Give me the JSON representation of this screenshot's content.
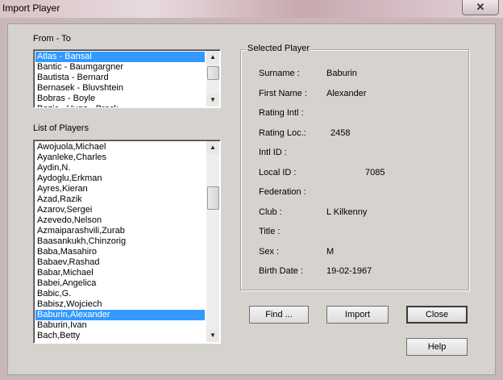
{
  "window": {
    "title": "Import Player",
    "close_glyph": "✕"
  },
  "from_to": {
    "label": "From - To",
    "items": [
      "Atlas - Bansal",
      "Bantic - Baumgargner",
      "Bautista - Bernard",
      "Bernasek - Bluvshtein",
      "Bobras - Boyle",
      "Bozic - Hugo - Brock"
    ],
    "selected_index": 0
  },
  "players": {
    "label": "List of Players",
    "items": [
      "Awojuola,Michael",
      "Ayanleke,Charles",
      "Aydin,N.",
      "Aydoglu,Erkman",
      "Ayres,Kieran",
      "Azad,Razik",
      "Azarov,Sergei",
      "Azevedo,Nelson",
      "Azmaiparashvili,Zurab",
      "Baasankukh,Chinzorig",
      "Baba,Masahiro",
      "Babaev,Rashad",
      "Babar,Michael",
      "Babei,Angelica",
      "Babic,G.",
      "Babisz,Wojciech",
      "Baburin,Alexander",
      "Baburin,Ivan",
      "Bach,Betty"
    ],
    "selected_index": 16
  },
  "selected_player": {
    "legend": "Selected Player",
    "fields": [
      {
        "label": "Surname :",
        "value": "Baburin"
      },
      {
        "label": "First Name :",
        "value": "Alexander"
      },
      {
        "label": "Rating Intl :",
        "value": ""
      },
      {
        "label": "Rating Loc.:",
        "value": "2458"
      },
      {
        "label": "Intl ID :",
        "value": ""
      },
      {
        "label": "Local ID :",
        "value": "7085"
      },
      {
        "label": "Federation :",
        "value": ""
      },
      {
        "label": "Club :",
        "value": "L Kilkenny"
      },
      {
        "label": "Title :",
        "value": ""
      },
      {
        "label": "Sex :",
        "value": "M"
      },
      {
        "label": "Birth Date :",
        "value": "19-02-1967"
      }
    ]
  },
  "buttons": {
    "find": "Find ...",
    "import": "Import",
    "close": "Close",
    "help": "Help"
  },
  "scroll_arrows": {
    "up": "▲",
    "down": "▼"
  }
}
